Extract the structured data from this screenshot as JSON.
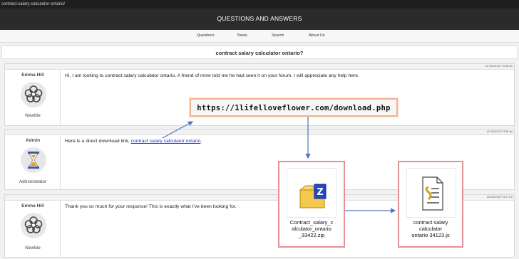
{
  "browser": {
    "url": "contract-salary-calculator-ontario/"
  },
  "site": {
    "title": "QUESTIONS AND ANSWERS"
  },
  "nav": {
    "items": [
      "Questions",
      "News",
      "Search",
      "About Us"
    ]
  },
  "thread": {
    "title": "contract salary calculator ontario?"
  },
  "posts": [
    {
      "author": "Emma Hill",
      "role": "Newbie",
      "avatar_icon": "flower-icon",
      "date": "#1 2022/12/27 10:35 am",
      "text": "Hi, I am looking to contract salary calculator ontario. A friend of mine told me he had seen it on your forum. I will appreciate any help here."
    },
    {
      "author": "Admin",
      "role": "Administrator",
      "avatar_icon": "hourglass-icon",
      "date": "#2 2022/12/27 5:36 am",
      "text_prefix": "Here is a direct download link, ",
      "link_text": "contract salary calculator ontario",
      "text_suffix": "."
    },
    {
      "author": "Emma Hill",
      "role": "Newbie",
      "avatar_icon": "flower-icon",
      "date": "#3 2022/12/27 6:17 pm",
      "text": "Thank you so much for your response! This is exactly what I've been looking for."
    }
  ],
  "annotation": {
    "url": "https://1lifelloveflower.com/download.php",
    "zip_file": {
      "name_lines": [
        "Contract_salary_c",
        "alculator_ontario",
        "_33422.zip"
      ],
      "icon": "zip-archive-icon"
    },
    "js_file": {
      "name_lines": [
        "contract salary",
        "calculator",
        "ontario 34123.js"
      ],
      "icon": "script-file-icon"
    }
  },
  "colors": {
    "header_bg": "#2b2b2b",
    "link": "#1a33d6",
    "callout_border": "#f3b58d",
    "filebox_border": "#e58f96",
    "arrow": "#4a78c4"
  }
}
